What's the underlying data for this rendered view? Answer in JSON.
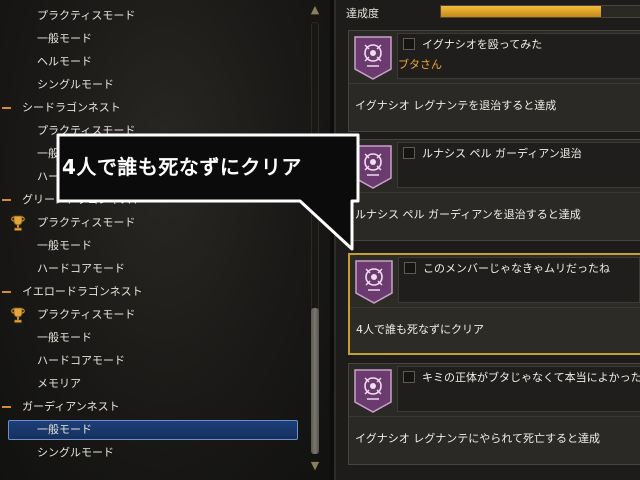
{
  "tree": {
    "items": [
      {
        "type": "mode",
        "label": "プラクティスモード",
        "trophy": false,
        "selected": false
      },
      {
        "type": "mode",
        "label": "一般モード",
        "trophy": false,
        "selected": false
      },
      {
        "type": "mode",
        "label": "ヘルモード",
        "trophy": false,
        "selected": false
      },
      {
        "type": "mode",
        "label": "シングルモード",
        "trophy": false,
        "selected": false
      },
      {
        "type": "cat",
        "label": "シードラゴンネスト",
        "trophy": false,
        "selected": false
      },
      {
        "type": "mode",
        "label": "プラクティスモード",
        "trophy": false,
        "selected": false
      },
      {
        "type": "mode",
        "label": "一般モード",
        "trophy": false,
        "selected": false
      },
      {
        "type": "mode",
        "label": "ハードコアモード",
        "trophy": false,
        "selected": false
      },
      {
        "type": "cat",
        "label": "グリーンドラゴンネスト",
        "trophy": false,
        "selected": false
      },
      {
        "type": "mode",
        "label": "プラクティスモード",
        "trophy": true,
        "selected": false
      },
      {
        "type": "mode",
        "label": "一般モード",
        "trophy": false,
        "selected": false
      },
      {
        "type": "mode",
        "label": "ハードコアモード",
        "trophy": false,
        "selected": false
      },
      {
        "type": "cat",
        "label": "イエロードラゴンネスト",
        "trophy": false,
        "selected": false
      },
      {
        "type": "mode",
        "label": "プラクティスモード",
        "trophy": true,
        "selected": false
      },
      {
        "type": "mode",
        "label": "一般モード",
        "trophy": false,
        "selected": false
      },
      {
        "type": "mode",
        "label": "ハードコアモード",
        "trophy": false,
        "selected": false
      },
      {
        "type": "mode",
        "label": "メモリア",
        "trophy": false,
        "selected": false
      },
      {
        "type": "cat",
        "label": "ガーディアンネスト",
        "trophy": false,
        "selected": false
      },
      {
        "type": "mode",
        "label": "一般モード",
        "trophy": false,
        "selected": true
      },
      {
        "type": "mode",
        "label": "シングルモード",
        "trophy": false,
        "selected": false
      }
    ]
  },
  "progress": {
    "label": "達成度",
    "fill_fraction": 0.8
  },
  "cards": [
    {
      "title": "イグナシオを殴ってみた",
      "reward": "ブタさん",
      "description": "イグナシオ レグナンテを退治すると達成",
      "highlight": false
    },
    {
      "title": "ルナシス ペル ガーディアン退治",
      "reward": "",
      "description": "ルナシス ペル ガーディアンを退治すると達成",
      "highlight": false
    },
    {
      "title": "このメンバーじゃなきゃムリだったね",
      "reward": "",
      "description": "4人で誰も死なずにクリア",
      "highlight": true
    },
    {
      "title": "キミの正体がブタじゃなくて本当によかった",
      "reward": "",
      "description": "イグナシオ レグナンテにやられて死亡すると達成",
      "highlight": false
    }
  ],
  "callout": {
    "text": "4人で誰も死なずにクリア"
  },
  "icons": {
    "trophy": "trophy-icon",
    "emblem": "achievement-emblem-icon",
    "scroll_up": "chevron-up-icon",
    "scroll_down": "chevron-down-icon"
  },
  "colors": {
    "accent_orange": "#d88a2c",
    "progress_gold": "#e6a62a",
    "selected_blue": "#1d3f78",
    "reward_orange": "#f1a435",
    "highlight_gold": "#c2a12c"
  }
}
